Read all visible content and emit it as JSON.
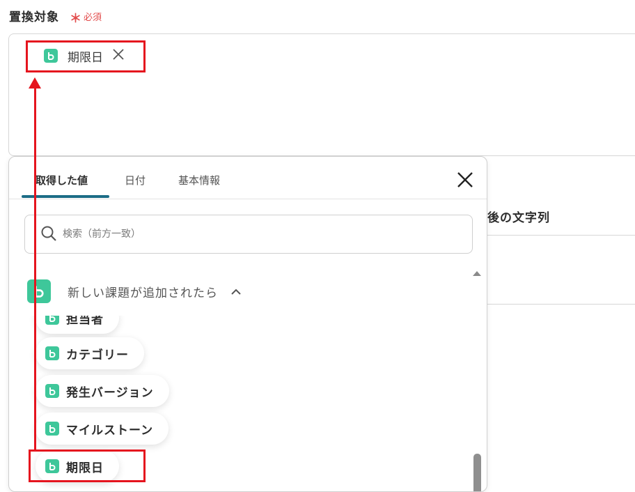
{
  "field": {
    "label": "置換対象",
    "required_mark": "＊",
    "required_text": "必須",
    "chip_label": "期限日",
    "chip_close": "×"
  },
  "after_field": {
    "label": "換後の文字列"
  },
  "popup": {
    "tabs": [
      {
        "label": "取得した値",
        "active": true
      },
      {
        "label": "日付",
        "active": false
      },
      {
        "label": "基本情報",
        "active": false
      }
    ],
    "search_placeholder": "検索（前方一致）",
    "group_title": "新しい課題が追加されたら",
    "items": [
      {
        "label": "担当者"
      },
      {
        "label": "カテゴリー"
      },
      {
        "label": "発生バージョン"
      },
      {
        "label": "マイルストーン"
      },
      {
        "label": "期限日"
      }
    ]
  },
  "colors": {
    "brand_icon": "#3ec79a",
    "tab_underline": "#1c6c86",
    "required": "#e24b4b",
    "annotation_red": "#e5141e"
  },
  "icons": {
    "brand": "backlog-icon",
    "search": "search-icon",
    "close": "close-icon",
    "chevron": "chevron-up-icon"
  }
}
